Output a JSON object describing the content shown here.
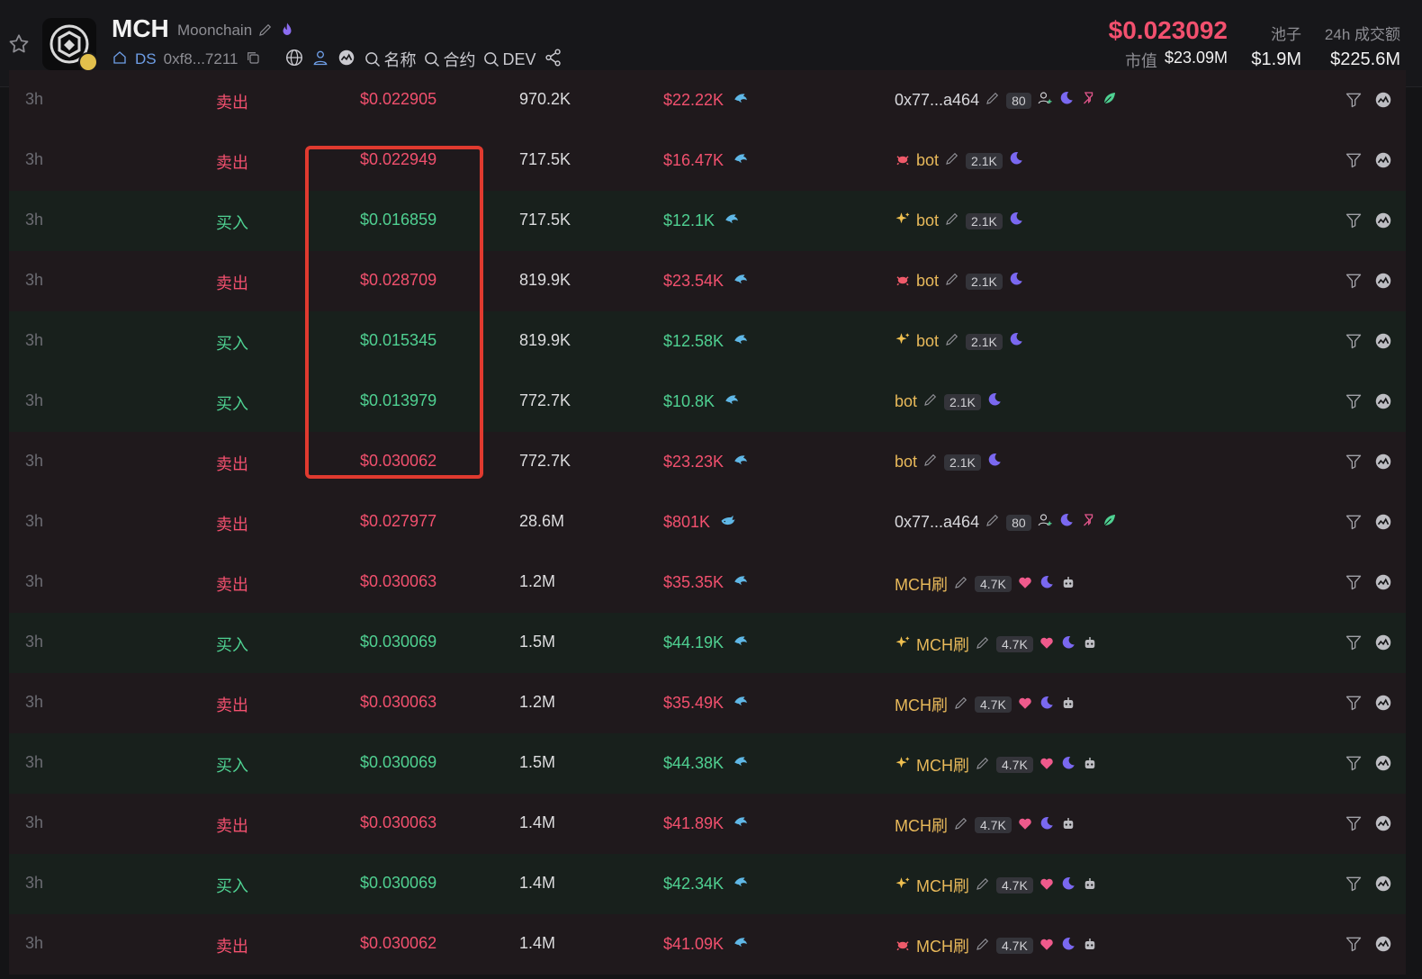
{
  "token": {
    "symbol": "MCH",
    "name": "Moonchain",
    "chain_label": "DS",
    "address": "0xf8...7211",
    "links": [
      "名称",
      "合约",
      "DEV"
    ]
  },
  "stats": {
    "price": "$0.023092",
    "mcap_label": "市值",
    "mcap_value": "$23.09M",
    "pool_label": "池子",
    "pool_value": "$1.9M",
    "volume_label": "24h 成交额",
    "volume_value": "$225.6M"
  },
  "colors": {
    "sell": "#f2506e",
    "buy": "#4fd192",
    "maker": "#e8b95a",
    "highlight": "#e03a2f"
  },
  "trades": [
    {
      "time": "3h",
      "type": "卖出",
      "side": "sell",
      "price": "$0.022905",
      "amount": "970.2K",
      "value": "$22.22K",
      "size_icon": "dolphin-icon",
      "maker": "0x77...a464",
      "maker_kind": "address",
      "count": "80",
      "tags": [
        "user-plus",
        "moon",
        "pin",
        "leaf"
      ]
    },
    {
      "time": "3h",
      "type": "卖出",
      "side": "sell",
      "price": "$0.022949",
      "amount": "717.5K",
      "value": "$16.47K",
      "size_icon": "dolphin-icon",
      "maker": "bot",
      "maker_kind": "bot",
      "prefix": "crab",
      "count": "2.1K",
      "tags": [
        "moon"
      ]
    },
    {
      "time": "3h",
      "type": "买入",
      "side": "buy",
      "price": "$0.016859",
      "amount": "717.5K",
      "value": "$12.1K",
      "size_icon": "dolphin-icon",
      "maker": "bot",
      "maker_kind": "bot",
      "prefix": "sparkle",
      "count": "2.1K",
      "tags": [
        "moon"
      ]
    },
    {
      "time": "3h",
      "type": "卖出",
      "side": "sell",
      "price": "$0.028709",
      "amount": "819.9K",
      "value": "$23.54K",
      "size_icon": "dolphin-icon",
      "maker": "bot",
      "maker_kind": "bot",
      "prefix": "crab",
      "count": "2.1K",
      "tags": [
        "moon"
      ]
    },
    {
      "time": "3h",
      "type": "买入",
      "side": "buy",
      "price": "$0.015345",
      "amount": "819.9K",
      "value": "$12.58K",
      "size_icon": "dolphin-icon",
      "maker": "bot",
      "maker_kind": "bot",
      "prefix": "sparkle",
      "count": "2.1K",
      "tags": [
        "moon"
      ]
    },
    {
      "time": "3h",
      "type": "买入",
      "side": "buy",
      "price": "$0.013979",
      "amount": "772.7K",
      "value": "$10.8K",
      "size_icon": "dolphin-icon",
      "maker": "bot",
      "maker_kind": "bot",
      "prefix": "",
      "count": "2.1K",
      "tags": [
        "moon"
      ]
    },
    {
      "time": "3h",
      "type": "卖出",
      "side": "sell",
      "price": "$0.030062",
      "amount": "772.7K",
      "value": "$23.23K",
      "size_icon": "dolphin-icon",
      "maker": "bot",
      "maker_kind": "bot",
      "prefix": "",
      "count": "2.1K",
      "tags": [
        "moon"
      ]
    },
    {
      "time": "3h",
      "type": "卖出",
      "side": "sell",
      "price": "$0.027977",
      "amount": "28.6M",
      "value": "$801K",
      "size_icon": "whale-icon",
      "maker": "0x77...a464",
      "maker_kind": "address",
      "count": "80",
      "tags": [
        "user-plus",
        "moon",
        "pin",
        "leaf"
      ]
    },
    {
      "time": "3h",
      "type": "卖出",
      "side": "sell",
      "price": "$0.030063",
      "amount": "1.2M",
      "value": "$35.35K",
      "size_icon": "dolphin-icon",
      "maker": "MCH刷",
      "maker_kind": "bot",
      "prefix": "",
      "count": "4.7K",
      "tags": [
        "heart",
        "moon",
        "robot"
      ]
    },
    {
      "time": "3h",
      "type": "买入",
      "side": "buy",
      "price": "$0.030069",
      "amount": "1.5M",
      "value": "$44.19K",
      "size_icon": "dolphin-icon",
      "maker": "MCH刷",
      "maker_kind": "bot",
      "prefix": "sparkle",
      "count": "4.7K",
      "tags": [
        "heart",
        "moon",
        "robot"
      ]
    },
    {
      "time": "3h",
      "type": "卖出",
      "side": "sell",
      "price": "$0.030063",
      "amount": "1.2M",
      "value": "$35.49K",
      "size_icon": "dolphin-icon",
      "maker": "MCH刷",
      "maker_kind": "bot",
      "prefix": "",
      "count": "4.7K",
      "tags": [
        "heart",
        "moon",
        "robot"
      ]
    },
    {
      "time": "3h",
      "type": "买入",
      "side": "buy",
      "price": "$0.030069",
      "amount": "1.5M",
      "value": "$44.38K",
      "size_icon": "dolphin-icon",
      "maker": "MCH刷",
      "maker_kind": "bot",
      "prefix": "sparkle",
      "count": "4.7K",
      "tags": [
        "heart",
        "moon",
        "robot"
      ]
    },
    {
      "time": "3h",
      "type": "卖出",
      "side": "sell",
      "price": "$0.030063",
      "amount": "1.4M",
      "value": "$41.89K",
      "size_icon": "dolphin-icon",
      "maker": "MCH刷",
      "maker_kind": "bot",
      "prefix": "",
      "count": "4.7K",
      "tags": [
        "heart",
        "moon",
        "robot"
      ]
    },
    {
      "time": "3h",
      "type": "买入",
      "side": "buy",
      "price": "$0.030069",
      "amount": "1.4M",
      "value": "$42.34K",
      "size_icon": "dolphin-icon",
      "maker": "MCH刷",
      "maker_kind": "bot",
      "prefix": "sparkle",
      "count": "4.7K",
      "tags": [
        "heart",
        "moon",
        "robot"
      ]
    },
    {
      "time": "3h",
      "type": "卖出",
      "side": "sell",
      "price": "$0.030062",
      "amount": "1.4M",
      "value": "$41.09K",
      "size_icon": "dolphin-icon",
      "maker": "MCH刷",
      "maker_kind": "bot",
      "prefix": "crab",
      "count": "4.7K",
      "tags": [
        "heart",
        "moon",
        "robot"
      ]
    }
  ]
}
